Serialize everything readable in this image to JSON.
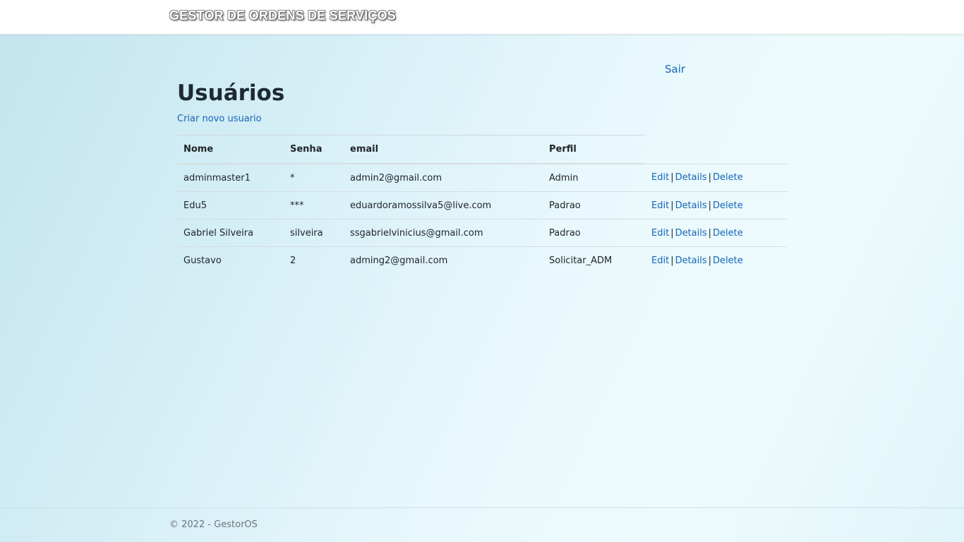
{
  "navbar": {
    "brand": "GESTOR DE ORDENS DE SERVIÇOS"
  },
  "logout_label": "Sair",
  "page": {
    "title": "Usuários",
    "create_link": "Criar novo usuario"
  },
  "table": {
    "headers": {
      "nome": "Nome",
      "senha": "Senha",
      "email": "email",
      "perfil": "Perfil"
    },
    "rows": [
      {
        "nome": "adminmaster1",
        "senha": "*",
        "email": "admin2@gmail.com",
        "perfil": "Admin"
      },
      {
        "nome": "Edu5",
        "senha": "***",
        "email": "eduardoramossilva5@live.com",
        "perfil": "Padrao"
      },
      {
        "nome": "Gabriel Silveira",
        "senha": "silveira",
        "email": "ssgabrielvinicius@gmail.com",
        "perfil": "Padrao"
      },
      {
        "nome": "Gustavo",
        "senha": "2",
        "email": "adming2@gmail.com",
        "perfil": "Solicitar_ADM"
      }
    ],
    "actions": {
      "edit": "Edit",
      "details": "Details",
      "delete": "Delete",
      "separator": "|"
    }
  },
  "footer": {
    "text": "© 2022 - GestorOS"
  },
  "colors": {
    "link": "#1565b8",
    "title": "#1e2a33",
    "footer_text": "#6c757d"
  }
}
